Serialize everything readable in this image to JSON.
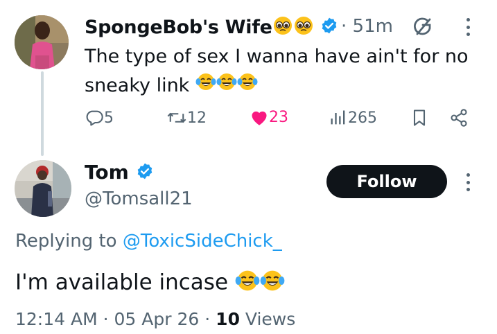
{
  "parent_tweet": {
    "display_name": "SpongeBob's Wife",
    "name_emojis": [
      "pleading-face-emoji",
      "pleading-face-emoji"
    ],
    "verified": true,
    "separator": "·",
    "time_ago": "51m",
    "text": "The type of sex I wanna have ain't for no sneaky link",
    "text_emojis": [
      "tears-of-joy-emoji",
      "tears-of-joy-emoji",
      "tears-of-joy-emoji"
    ],
    "actions": {
      "replies": "5",
      "reposts": "12",
      "likes": "23",
      "views": "265"
    },
    "liked": true
  },
  "reply_tweet": {
    "display_name": "Tom",
    "verified": true,
    "handle": "@Tomsall21",
    "follow_label": "Follow",
    "replying_prefix": "Replying to ",
    "replying_to": "@ToxicSideChick_",
    "text": "I'm available incase",
    "text_emojis": [
      "tears-of-joy-emoji",
      "tears-of-joy-emoji"
    ],
    "time": "12:14 AM",
    "date": "05 Apr 26",
    "views_count": "10",
    "views_label": "Views",
    "separator": "·"
  },
  "colors": {
    "accent_blue": "#1d9bf0",
    "like_pink": "#f91880",
    "secondary_text": "#536471",
    "primary_text": "#0f1419"
  }
}
